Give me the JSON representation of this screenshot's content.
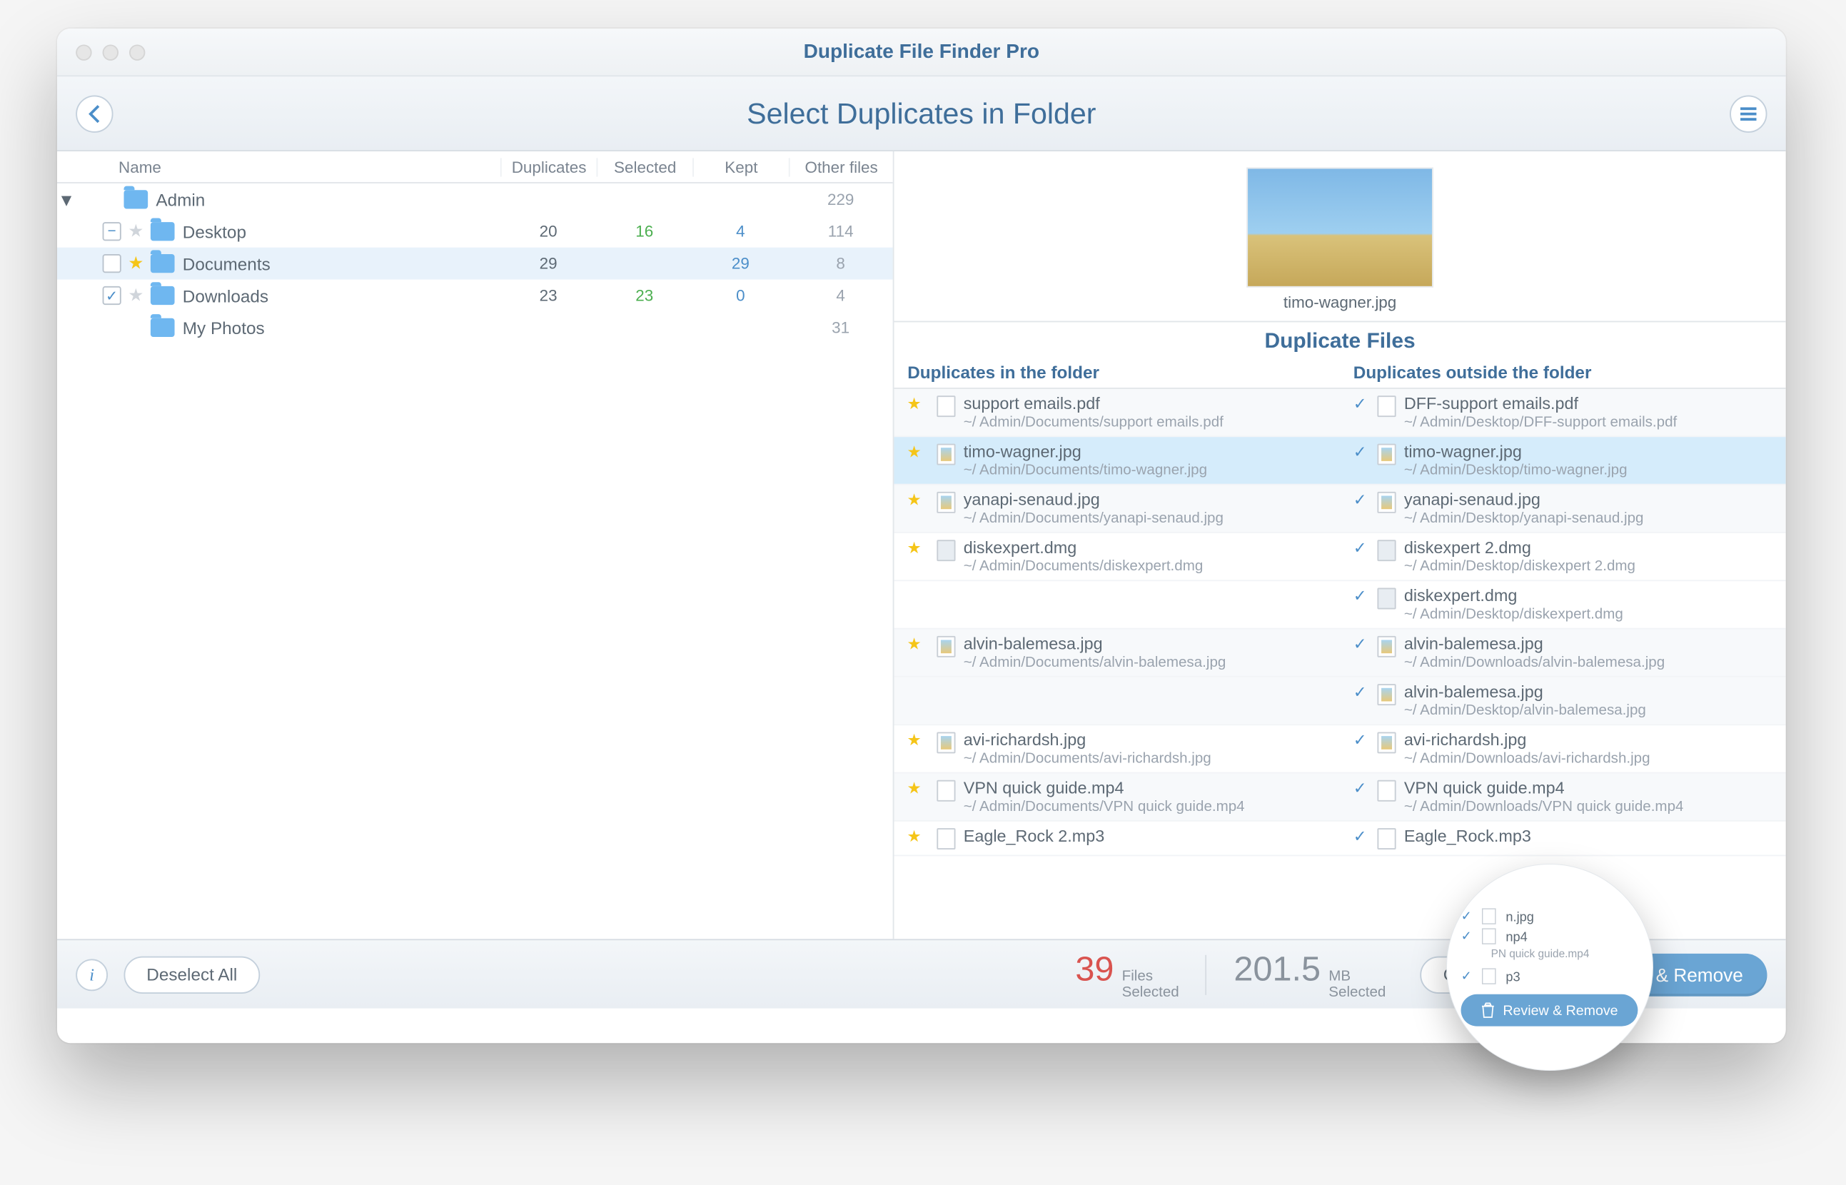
{
  "app_title": "Duplicate File Finder Pro",
  "page_title": "Select Duplicates in Folder",
  "columns": {
    "name": "Name",
    "duplicates": "Duplicates",
    "selected": "Selected",
    "kept": "Kept",
    "other": "Other files"
  },
  "tree": [
    {
      "name": "Admin",
      "check": "",
      "star": false,
      "dup": "",
      "sel": "",
      "kept": "",
      "other": "229",
      "indent": 0,
      "disclose": "▼"
    },
    {
      "name": "Desktop",
      "check": "mixed",
      "star": false,
      "dup": "20",
      "sel": "16",
      "kept": "4",
      "other": "114",
      "indent": 1
    },
    {
      "name": "Documents",
      "check": "empty",
      "star": true,
      "dup": "29",
      "sel": "",
      "kept": "29",
      "other": "8",
      "indent": 1,
      "selected": true
    },
    {
      "name": "Downloads",
      "check": "checked",
      "star": false,
      "dup": "23",
      "sel": "23",
      "kept": "0",
      "other": "4",
      "indent": 1
    },
    {
      "name": "My Photos",
      "check": "",
      "star": false,
      "dup": "",
      "sel": "",
      "kept": "",
      "other": "31",
      "indent": 1
    }
  ],
  "preview": {
    "filename": "timo-wagner.jpg"
  },
  "dup_section_title": "Duplicate Files",
  "dup_headers": {
    "inside": "Duplicates in the folder",
    "outside": "Duplicates outside the folder"
  },
  "duplicates": [
    {
      "inside": [
        {
          "mark": "star",
          "icon": "doc",
          "name": "support emails.pdf",
          "path": "~/ Admin/Documents/support emails.pdf"
        }
      ],
      "outside": [
        {
          "mark": "check",
          "icon": "doc",
          "name": "DFF-support emails.pdf",
          "path": "~/ Admin/Desktop/DFF-support emails.pdf"
        }
      ]
    },
    {
      "highlight": true,
      "inside": [
        {
          "mark": "star",
          "icon": "img",
          "name": "timo-wagner.jpg",
          "path": "~/ Admin/Documents/timo-wagner.jpg"
        }
      ],
      "outside": [
        {
          "mark": "check",
          "icon": "img",
          "name": "timo-wagner.jpg",
          "path": "~/ Admin/Desktop/timo-wagner.jpg"
        }
      ]
    },
    {
      "inside": [
        {
          "mark": "star",
          "icon": "img",
          "name": "yanapi-senaud.jpg",
          "path": "~/ Admin/Documents/yanapi-senaud.jpg"
        }
      ],
      "outside": [
        {
          "mark": "check",
          "icon": "img",
          "name": "yanapi-senaud.jpg",
          "path": "~/ Admin/Desktop/yanapi-senaud.jpg"
        }
      ]
    },
    {
      "inside": [
        {
          "mark": "star",
          "icon": "dmg",
          "name": "diskexpert.dmg",
          "path": "~/ Admin/Documents/diskexpert.dmg"
        }
      ],
      "outside": [
        {
          "mark": "check",
          "icon": "dmg",
          "name": "diskexpert 2.dmg",
          "path": "~/ Admin/Desktop/diskexpert 2.dmg"
        },
        {
          "mark": "check",
          "icon": "dmg",
          "name": "diskexpert.dmg",
          "path": "~/ Admin/Desktop/diskexpert.dmg"
        }
      ]
    },
    {
      "inside": [
        {
          "mark": "star",
          "icon": "img",
          "name": "alvin-balemesa.jpg",
          "path": "~/ Admin/Documents/alvin-balemesa.jpg"
        }
      ],
      "outside": [
        {
          "mark": "check",
          "icon": "img",
          "name": "alvin-balemesa.jpg",
          "path": "~/ Admin/Downloads/alvin-balemesa.jpg"
        },
        {
          "mark": "check",
          "icon": "img",
          "name": "alvin-balemesa.jpg",
          "path": "~/ Admin/Desktop/alvin-balemesa.jpg"
        }
      ]
    },
    {
      "inside": [
        {
          "mark": "star",
          "icon": "img",
          "name": "avi-richardsh.jpg",
          "path": "~/ Admin/Documents/avi-richardsh.jpg"
        }
      ],
      "outside": [
        {
          "mark": "check",
          "icon": "img",
          "name": "avi-richardsh.jpg",
          "path": "~/ Admin/Downloads/avi-richardsh.jpg"
        }
      ]
    },
    {
      "inside": [
        {
          "mark": "star",
          "icon": "vid",
          "name": "VPN quick guide.mp4",
          "path": "~/ Admin/Documents/VPN quick guide.mp4"
        }
      ],
      "outside": [
        {
          "mark": "check",
          "icon": "vid",
          "name": "VPN quick guide.mp4",
          "path": "~/ Admin/Downloads/VPN quick guide.mp4"
        }
      ]
    },
    {
      "inside": [
        {
          "mark": "star",
          "icon": "aud",
          "name": "Eagle_Rock 2.mp3",
          "path": ""
        }
      ],
      "outside": [
        {
          "mark": "check",
          "icon": "aud",
          "name": "Eagle_Rock.mp3",
          "path": ""
        }
      ]
    }
  ],
  "footer": {
    "deselect_label": "Deselect All",
    "files_count": "39",
    "files_label": "Files\nSelected",
    "size_value": "201.5",
    "size_label": "MB\nSelected",
    "cancel_label": "Cancel",
    "review_label": "Review & Remove"
  },
  "magnifier": {
    "items": [
      {
        "name": "n.jpg",
        "path": ""
      },
      {
        "name": "np4",
        "path": "PN quick guide.mp4"
      },
      {
        "name": "p3",
        "path": ""
      }
    ],
    "button": "Review & Remove"
  }
}
